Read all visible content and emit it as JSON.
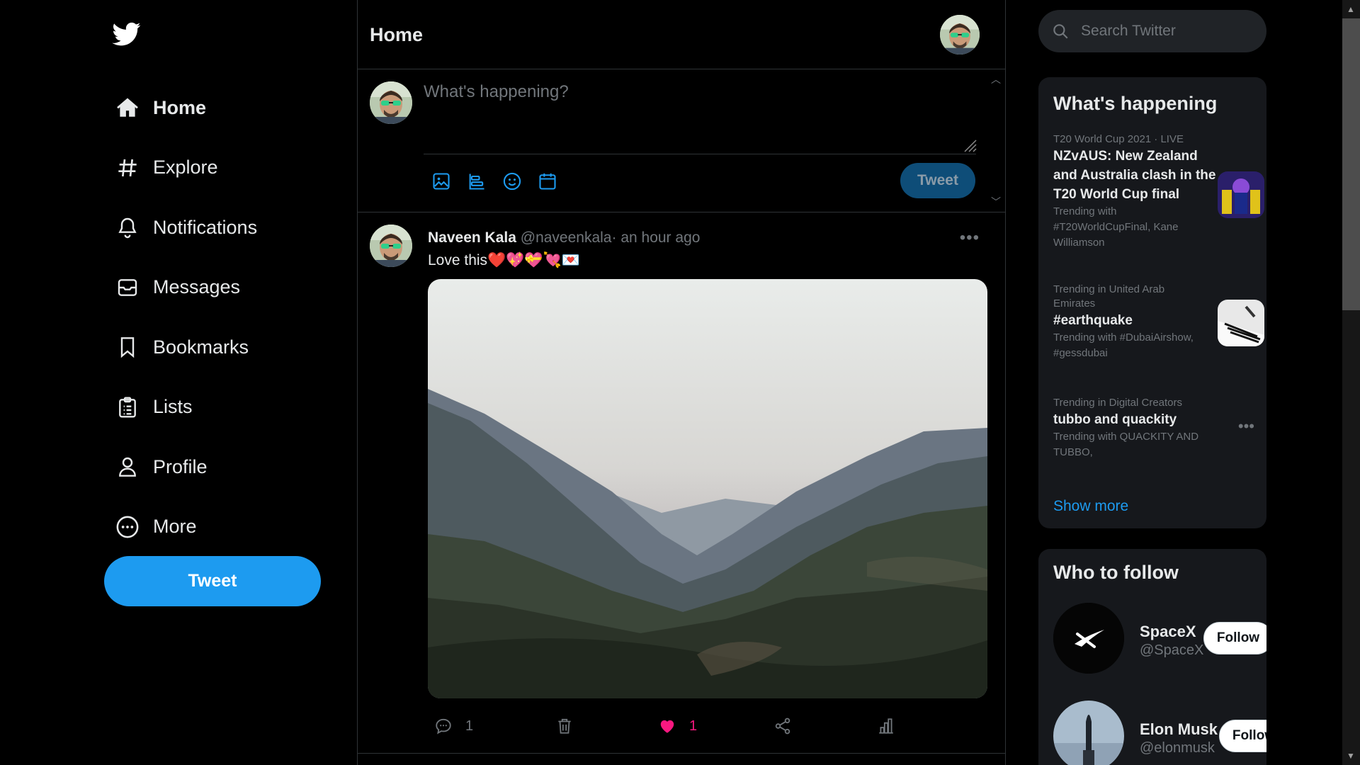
{
  "app": {
    "brand": "twitter-logo"
  },
  "nav": {
    "items": [
      {
        "label": "Home",
        "icon": "home-icon"
      },
      {
        "label": "Explore",
        "icon": "hashtag-icon"
      },
      {
        "label": "Notifications",
        "icon": "bell-icon"
      },
      {
        "label": "Messages",
        "icon": "envelope-icon"
      },
      {
        "label": "Bookmarks",
        "icon": "bookmark-icon"
      },
      {
        "label": "Lists",
        "icon": "lists-icon"
      },
      {
        "label": "Profile",
        "icon": "person-icon"
      },
      {
        "label": "More",
        "icon": "more-circle-icon"
      }
    ],
    "tweet_label": "Tweet"
  },
  "header": {
    "title": "Home"
  },
  "composer": {
    "placeholder": "What's happening?",
    "tweet_label": "Tweet",
    "tools": [
      "image-icon",
      "poll-icon",
      "emoji-icon",
      "schedule-icon"
    ]
  },
  "tweet": {
    "name": "Naveen Kala",
    "handle": "@naveenkala",
    "time": "· an hour ago",
    "text": "Love this❤️💖💝💘💌",
    "reply_count": "1",
    "like_count": "1",
    "liked": true
  },
  "search": {
    "placeholder": "Search Twitter"
  },
  "happening": {
    "title": "What's happening",
    "trends": [
      {
        "context": "T20 World Cup 2021 · LIVE",
        "title": "NZvAUS: New Zealand and Australia clash in the T20 World Cup final",
        "sub": "Trending with #T20WorldCupFinal, Kane Williamson"
      },
      {
        "context": "Trending in United Arab Emirates",
        "title": "#earthquake",
        "sub": "Trending with #DubaiAirshow, #gessdubai"
      },
      {
        "context": "Trending in Digital Creators",
        "title": "tubbo and quackity",
        "sub": "Trending with QUACKITY AND TUBBO,"
      }
    ],
    "show_more": "Show more"
  },
  "who_to_follow": {
    "title": "Who to follow",
    "accounts": [
      {
        "name": "SpaceX",
        "handle": "@SpaceX",
        "button": "Follow"
      },
      {
        "name": "Elon Musk",
        "handle": "@elonmusk",
        "button": "Follow"
      }
    ]
  },
  "colors": {
    "accent": "#1d9bf0",
    "like": "#f91880",
    "background": "#000000",
    "card": "#16181c"
  }
}
